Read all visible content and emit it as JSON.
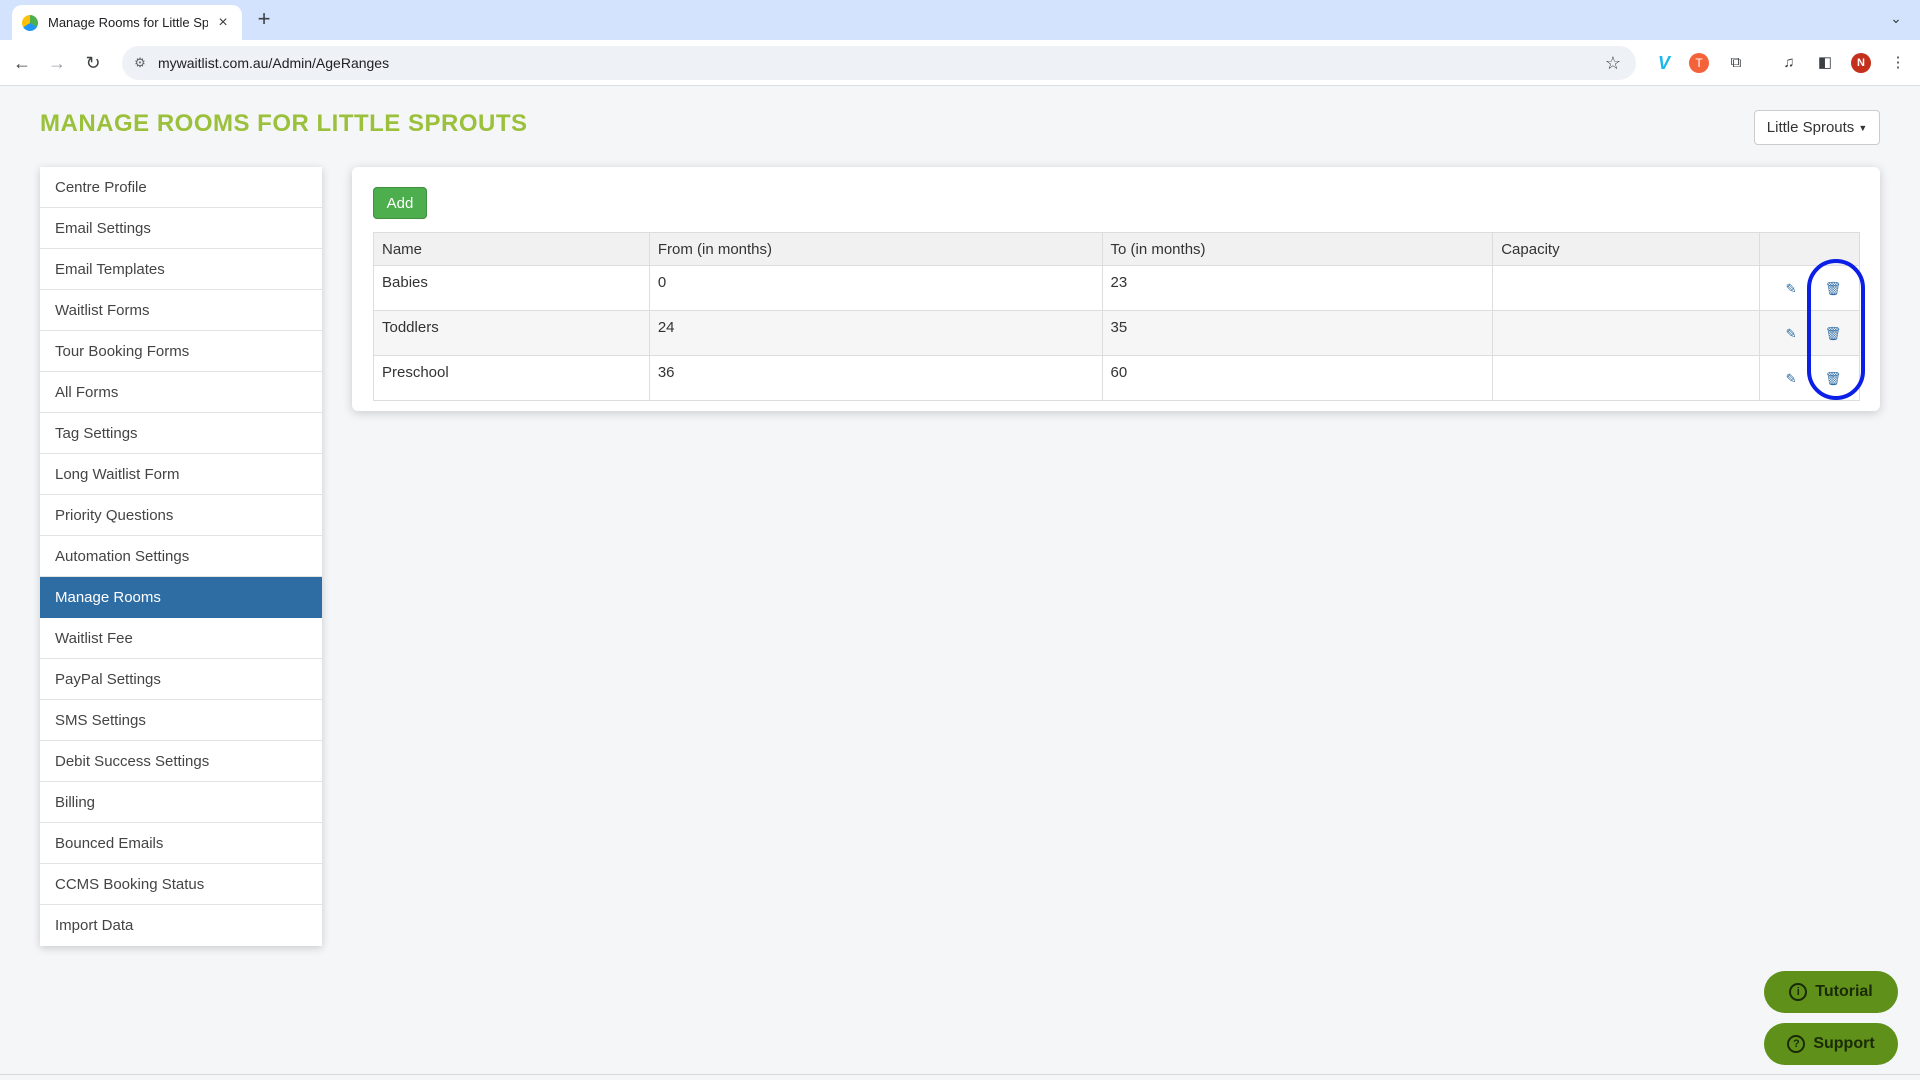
{
  "browser": {
    "tab_title": "Manage Rooms for Little Sprouts",
    "tab_close_icon": "×",
    "new_tab_icon": "+",
    "tab_menu_icon": "⌄",
    "back_icon": "←",
    "forward_icon": "→",
    "reload_icon": "↻",
    "site_info_icon": "⚙",
    "url": "mywaitlist.com.au/Admin/AgeRanges",
    "bookmark_icon": "☆",
    "extension_v_icon": "V",
    "extension_t_icon": "T",
    "extensions_icon": "⧉",
    "media_icon": "♫",
    "sidepanel_icon": "◧",
    "profile_initial": "N",
    "menu_icon": "⋮"
  },
  "header": {
    "title": "MANAGE ROOMS FOR LITTLE SPROUTS",
    "centre_selector": "Little Sprouts",
    "caret_icon": "▼"
  },
  "sidebar": {
    "items": [
      {
        "label": "Centre Profile"
      },
      {
        "label": "Email Settings"
      },
      {
        "label": "Email Templates"
      },
      {
        "label": "Waitlist Forms"
      },
      {
        "label": "Tour Booking Forms"
      },
      {
        "label": "All Forms"
      },
      {
        "label": "Tag Settings"
      },
      {
        "label": "Long Waitlist Form"
      },
      {
        "label": "Priority Questions"
      },
      {
        "label": "Automation Settings"
      },
      {
        "label": "Manage Rooms",
        "active": true
      },
      {
        "label": "Waitlist Fee"
      },
      {
        "label": "PayPal Settings"
      },
      {
        "label": "SMS Settings"
      },
      {
        "label": "Debit Success Settings"
      },
      {
        "label": "Billing"
      },
      {
        "label": "Bounced Emails"
      },
      {
        "label": "CCMS Booking Status"
      },
      {
        "label": "Import Data"
      }
    ]
  },
  "rooms": {
    "add_label": "Add",
    "columns": [
      "Name",
      "From (in months)",
      "To (in months)",
      "Capacity",
      ""
    ],
    "rows": [
      {
        "name": "Babies",
        "from": "0",
        "to": "23",
        "capacity": ""
      },
      {
        "name": "Toddlers",
        "from": "24",
        "to": "35",
        "capacity": ""
      },
      {
        "name": "Preschool",
        "from": "36",
        "to": "60",
        "capacity": ""
      }
    ],
    "edit_icon": "✎",
    "delete_icon": "🗑"
  },
  "help": {
    "tutorial_label": "Tutorial",
    "tutorial_icon": "i",
    "support_label": "Support",
    "support_icon": "?"
  },
  "colors": {
    "title_green": "#9bc13c",
    "active_blue": "#2e6da4",
    "add_green": "#4cae4c",
    "help_green": "#5f9019",
    "highlight_ring": "#0b1fe6"
  }
}
